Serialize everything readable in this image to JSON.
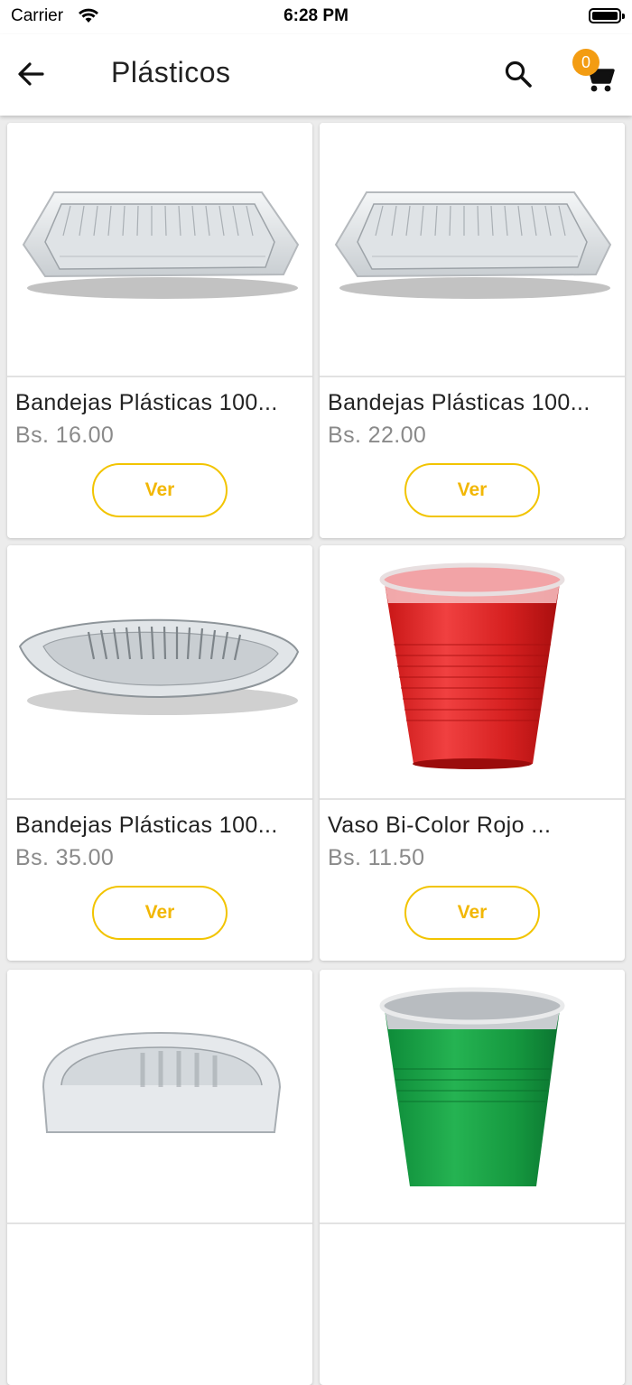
{
  "status_bar": {
    "carrier": "Carrier",
    "time": "6:28 PM"
  },
  "header": {
    "title": "Plásticos",
    "back_icon": "arrow-left-icon",
    "search_icon": "search-icon",
    "cart_icon": "cart-icon",
    "cart_count": "0"
  },
  "colors": {
    "accent_yellow": "#f2c400",
    "badge_orange": "#f39c12",
    "price_gray": "#8a8a8a"
  },
  "products": [
    {
      "name": "Bandejas Plásticas 100...",
      "price": "Bs. 16.00",
      "button": "Ver",
      "image": "rect-tray"
    },
    {
      "name": "Bandejas Plásticas 100...",
      "price": "Bs. 22.00",
      "button": "Ver",
      "image": "rect-tray"
    },
    {
      "name": "Bandejas Plásticas 100...",
      "price": "Bs. 35.00",
      "button": "Ver",
      "image": "oval-tray"
    },
    {
      "name": "Vaso Bi-Color Rojo ...",
      "price": "Bs. 11.50",
      "button": "Ver",
      "image": "red-cup"
    },
    {
      "name": "",
      "price": "",
      "button": "",
      "image": "clear-container"
    },
    {
      "name": "",
      "price": "",
      "button": "",
      "image": "green-cup"
    }
  ]
}
